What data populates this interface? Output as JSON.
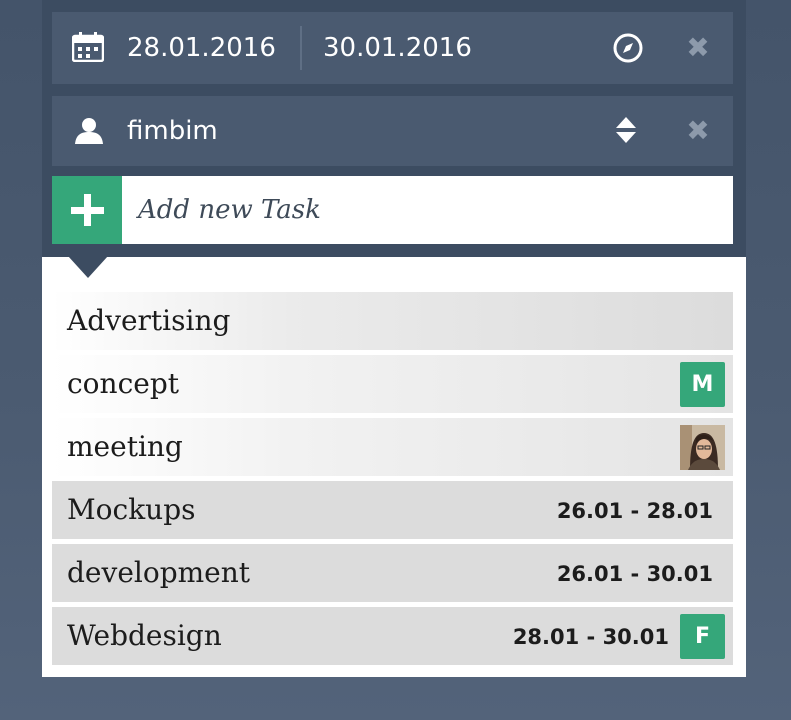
{
  "filters": {
    "date_from": "28.01.2016",
    "date_to": "30.01.2016",
    "user": "fimbim"
  },
  "new_task": {
    "placeholder": "Add new Task",
    "add_label": "+"
  },
  "clear_label": "✖",
  "tasks": [
    {
      "label": "Advertising",
      "date": "",
      "badge": ""
    },
    {
      "label": "concept",
      "date": "",
      "badge": "M"
    },
    {
      "label": "meeting",
      "date": "",
      "badge": ""
    },
    {
      "label": "Mockups",
      "date": "26.01 - 28.01",
      "badge": ""
    },
    {
      "label": "development",
      "date": "26.01 - 30.01",
      "badge": ""
    },
    {
      "label": "Webdesign",
      "date": "28.01 - 30.01",
      "badge": "F"
    }
  ],
  "colors": {
    "accent": "#35a77a",
    "panel": "#3c4c61",
    "bar": "#4a5a70",
    "row_gray": "#dcdcdc"
  }
}
